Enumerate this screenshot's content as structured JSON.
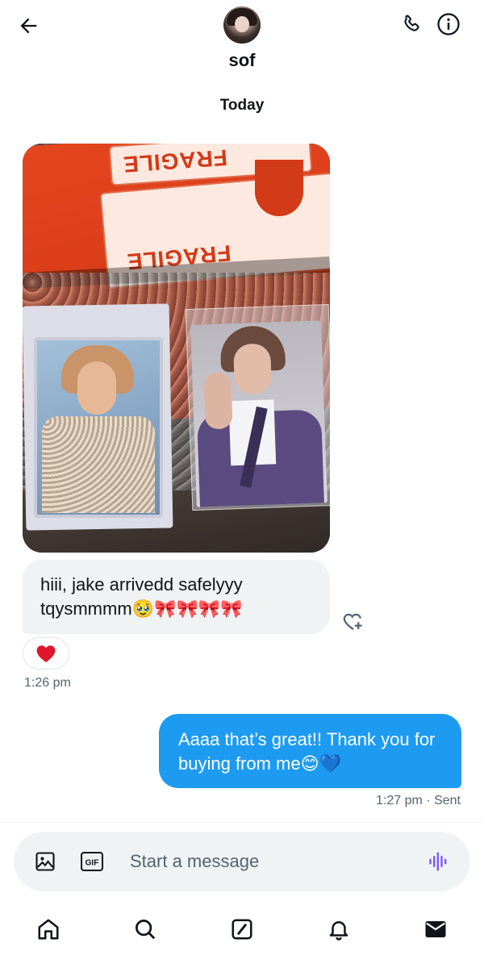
{
  "header": {
    "username": "sof",
    "icons": {
      "back": "arrow-left-icon",
      "call": "phone-icon",
      "info": "info-icon"
    }
  },
  "conversation": {
    "date_label": "Today",
    "incoming": {
      "text": "hiii, jake arrivedd safelyyy tqysmmmm🥹🎀🎀🎀🎀",
      "reaction": "❤️",
      "time": "1:26 pm"
    },
    "outgoing": {
      "text": "Aaaa that’s great!! Thank you for buying from me😊💙",
      "time": "1:27 pm",
      "status": "Sent",
      "time_status": "1:27 pm · Sent"
    },
    "photo_text": {
      "label_top": "FRAGILE",
      "label_bottom": "FRAGILE"
    }
  },
  "composer": {
    "placeholder": "Start a message",
    "gif_label": "GIF"
  },
  "colors": {
    "accent": "#1d9bf0",
    "incoming_bubble": "#eff3f4",
    "voice_icon": "#7856ff",
    "secondary_text": "#536471"
  },
  "tabbar": {
    "items": [
      "home-icon",
      "search-icon",
      "grok-icon",
      "notifications-icon",
      "messages-icon"
    ]
  }
}
